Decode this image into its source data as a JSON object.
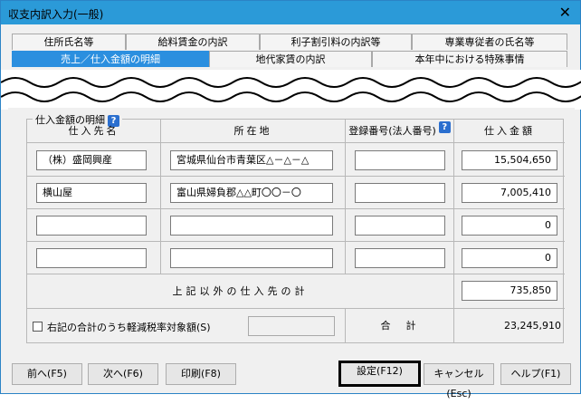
{
  "window": {
    "title": "収支内訳入力(一般)",
    "close_glyph": "✕"
  },
  "tabs": {
    "row1": [
      {
        "label": "住所氏名等"
      },
      {
        "label": "給料賃金の内訳"
      },
      {
        "label": "利子割引料の内訳等"
      },
      {
        "label": "専業専従者の氏名等"
      }
    ],
    "row2": [
      {
        "label": "売上／仕入金額の明細",
        "active": true
      },
      {
        "label": "地代家賃の内訳"
      },
      {
        "label": "本年中における特殊事情"
      }
    ]
  },
  "section": {
    "title": "仕入金額の明細",
    "help": "?",
    "headers": {
      "supplier": "仕入先名",
      "address": "所在地",
      "reg_no": "登録番号(法人番号)",
      "amount": "仕入金額"
    },
    "rows": [
      {
        "supplier": "（株）盛岡興産",
        "address": "宮城県仙台市青葉区△－△－△",
        "reg_no": "",
        "amount": "15,504,650"
      },
      {
        "supplier": "横山屋",
        "address": "富山県婦負郡△△町〇〇－〇",
        "reg_no": "",
        "amount": "7,005,410"
      },
      {
        "supplier": "",
        "address": "",
        "reg_no": "",
        "amount": "0"
      },
      {
        "supplier": "",
        "address": "",
        "reg_no": "",
        "amount": "0"
      }
    ],
    "other_label": "上記以外の仕入先の計",
    "other_amount": "735,850",
    "reduced_checkbox_label": "右記の合計のうち軽減税率対象額(S)",
    "reduced_amount": "",
    "total_label": "合　計",
    "total_amount": "23,245,910"
  },
  "buttons": {
    "prev": "前へ(F5)",
    "next": "次へ(F6)",
    "print": "印刷(F8)",
    "set": "設定(F12)",
    "cancel": "キャンセル(Esc)",
    "help": "ヘルプ(F1)"
  },
  "colors": {
    "titlebar": "#2b9ad8",
    "active_tab": "#2b8fdf",
    "help_badge": "#2b6fcf"
  }
}
